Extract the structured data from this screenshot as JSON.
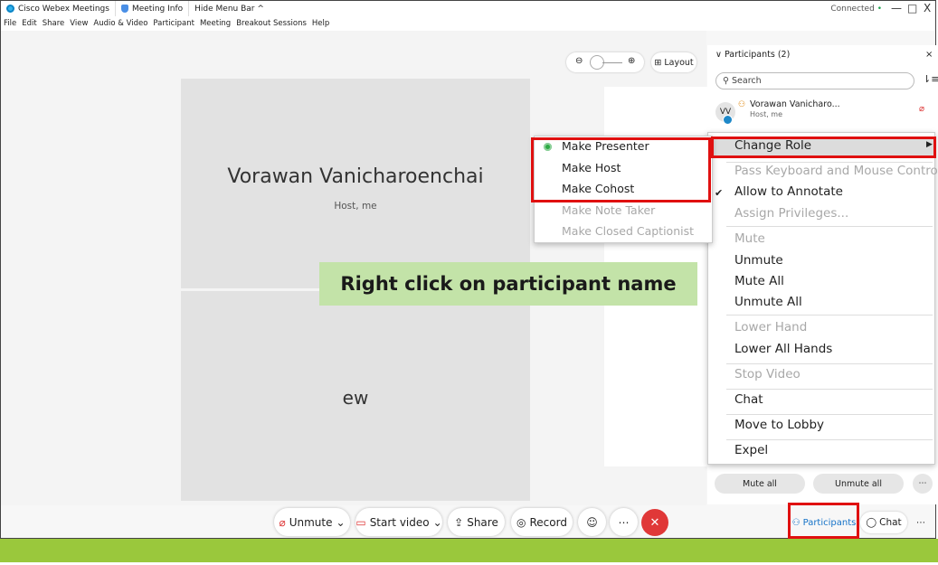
{
  "titlebar": {
    "app_name": "Cisco Webex Meetings",
    "meeting_info": "Meeting Info",
    "hide_menu": "Hide Menu Bar ^",
    "connection": "Connected",
    "connection_dot": "•",
    "minimize": "—",
    "restore": "□",
    "close": "X"
  },
  "menubar": [
    "File",
    "Edit",
    "Share",
    "View",
    "Audio & Video",
    "Participant",
    "Meeting",
    "Breakout Sessions",
    "Help"
  ],
  "stage": {
    "tile1_name": "Vorawan Vanicharoenchai",
    "tile1_role": "Host, me",
    "tile2_name": "ew",
    "zoom_out_icon": "⊖",
    "zoom_in_icon": "⊕",
    "layout_label": "Layout"
  },
  "participants_panel": {
    "title": "Participants (2)",
    "close": "×",
    "search_placeholder": "Search",
    "participant1": {
      "initials": "VV",
      "name": "Vorawan Vanicharo...",
      "role": "Host, me"
    },
    "mute_all": "Mute all",
    "unmute_all": "Unmute all",
    "more": "⋯"
  },
  "context_menu": {
    "change_role": "Change Role",
    "pass_control": "Pass Keyboard and Mouse Control",
    "allow_annotate": "Allow to Annotate",
    "assign_privileges": "Assign Privileges...",
    "mute": "Mute",
    "unmute": "Unmute",
    "mute_all": "Mute All",
    "unmute_all": "Unmute All",
    "lower_hand": "Lower Hand",
    "lower_all_hands": "Lower All Hands",
    "stop_video": "Stop Video",
    "chat": "Chat",
    "move_to_lobby": "Move to Lobby",
    "expel": "Expel"
  },
  "role_submenu": {
    "make_presenter": "Make Presenter",
    "make_host": "Make Host",
    "make_cohost": "Make Cohost",
    "make_note_taker": "Make Note Taker",
    "make_captionist": "Make Closed Captionist"
  },
  "callout": "Right click on participant name",
  "controls": {
    "unmute": "Unmute",
    "start_video": "Start video",
    "share": "Share",
    "record": "Record",
    "more": "⋯",
    "participants": "Participants",
    "chat": "Chat"
  },
  "colors": {
    "highlight_red": "#e01010",
    "callout_green": "#c3e3a8",
    "footer_green": "#9ac83c",
    "end_call_red": "#e03838",
    "accent_blue": "#1673c8"
  }
}
